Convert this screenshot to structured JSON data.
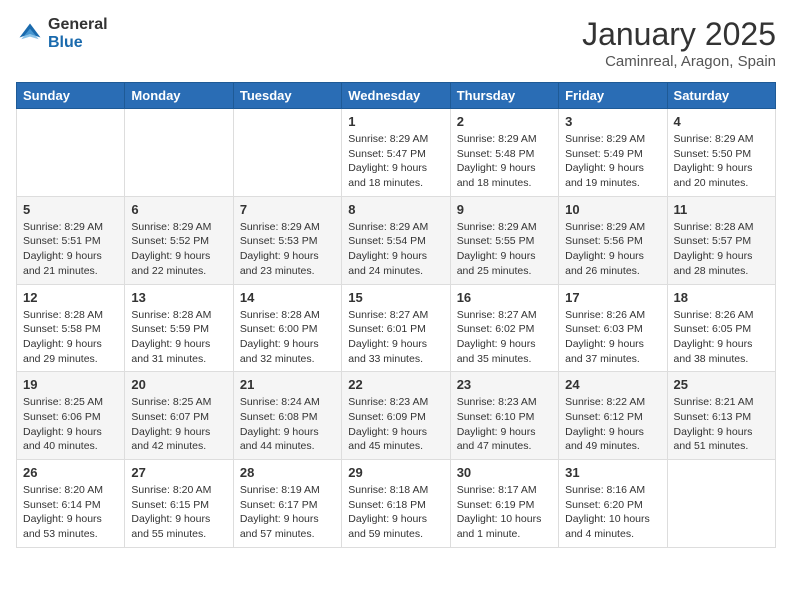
{
  "header": {
    "logo_general": "General",
    "logo_blue": "Blue",
    "month_title": "January 2025",
    "location": "Caminreal, Aragon, Spain"
  },
  "weekdays": [
    "Sunday",
    "Monday",
    "Tuesday",
    "Wednesday",
    "Thursday",
    "Friday",
    "Saturday"
  ],
  "weeks": [
    [
      {
        "day": "",
        "info": ""
      },
      {
        "day": "",
        "info": ""
      },
      {
        "day": "",
        "info": ""
      },
      {
        "day": "1",
        "info": "Sunrise: 8:29 AM\nSunset: 5:47 PM\nDaylight: 9 hours\nand 18 minutes."
      },
      {
        "day": "2",
        "info": "Sunrise: 8:29 AM\nSunset: 5:48 PM\nDaylight: 9 hours\nand 18 minutes."
      },
      {
        "day": "3",
        "info": "Sunrise: 8:29 AM\nSunset: 5:49 PM\nDaylight: 9 hours\nand 19 minutes."
      },
      {
        "day": "4",
        "info": "Sunrise: 8:29 AM\nSunset: 5:50 PM\nDaylight: 9 hours\nand 20 minutes."
      }
    ],
    [
      {
        "day": "5",
        "info": "Sunrise: 8:29 AM\nSunset: 5:51 PM\nDaylight: 9 hours\nand 21 minutes."
      },
      {
        "day": "6",
        "info": "Sunrise: 8:29 AM\nSunset: 5:52 PM\nDaylight: 9 hours\nand 22 minutes."
      },
      {
        "day": "7",
        "info": "Sunrise: 8:29 AM\nSunset: 5:53 PM\nDaylight: 9 hours\nand 23 minutes."
      },
      {
        "day": "8",
        "info": "Sunrise: 8:29 AM\nSunset: 5:54 PM\nDaylight: 9 hours\nand 24 minutes."
      },
      {
        "day": "9",
        "info": "Sunrise: 8:29 AM\nSunset: 5:55 PM\nDaylight: 9 hours\nand 25 minutes."
      },
      {
        "day": "10",
        "info": "Sunrise: 8:29 AM\nSunset: 5:56 PM\nDaylight: 9 hours\nand 26 minutes."
      },
      {
        "day": "11",
        "info": "Sunrise: 8:28 AM\nSunset: 5:57 PM\nDaylight: 9 hours\nand 28 minutes."
      }
    ],
    [
      {
        "day": "12",
        "info": "Sunrise: 8:28 AM\nSunset: 5:58 PM\nDaylight: 9 hours\nand 29 minutes."
      },
      {
        "day": "13",
        "info": "Sunrise: 8:28 AM\nSunset: 5:59 PM\nDaylight: 9 hours\nand 31 minutes."
      },
      {
        "day": "14",
        "info": "Sunrise: 8:28 AM\nSunset: 6:00 PM\nDaylight: 9 hours\nand 32 minutes."
      },
      {
        "day": "15",
        "info": "Sunrise: 8:27 AM\nSunset: 6:01 PM\nDaylight: 9 hours\nand 33 minutes."
      },
      {
        "day": "16",
        "info": "Sunrise: 8:27 AM\nSunset: 6:02 PM\nDaylight: 9 hours\nand 35 minutes."
      },
      {
        "day": "17",
        "info": "Sunrise: 8:26 AM\nSunset: 6:03 PM\nDaylight: 9 hours\nand 37 minutes."
      },
      {
        "day": "18",
        "info": "Sunrise: 8:26 AM\nSunset: 6:05 PM\nDaylight: 9 hours\nand 38 minutes."
      }
    ],
    [
      {
        "day": "19",
        "info": "Sunrise: 8:25 AM\nSunset: 6:06 PM\nDaylight: 9 hours\nand 40 minutes."
      },
      {
        "day": "20",
        "info": "Sunrise: 8:25 AM\nSunset: 6:07 PM\nDaylight: 9 hours\nand 42 minutes."
      },
      {
        "day": "21",
        "info": "Sunrise: 8:24 AM\nSunset: 6:08 PM\nDaylight: 9 hours\nand 44 minutes."
      },
      {
        "day": "22",
        "info": "Sunrise: 8:23 AM\nSunset: 6:09 PM\nDaylight: 9 hours\nand 45 minutes."
      },
      {
        "day": "23",
        "info": "Sunrise: 8:23 AM\nSunset: 6:10 PM\nDaylight: 9 hours\nand 47 minutes."
      },
      {
        "day": "24",
        "info": "Sunrise: 8:22 AM\nSunset: 6:12 PM\nDaylight: 9 hours\nand 49 minutes."
      },
      {
        "day": "25",
        "info": "Sunrise: 8:21 AM\nSunset: 6:13 PM\nDaylight: 9 hours\nand 51 minutes."
      }
    ],
    [
      {
        "day": "26",
        "info": "Sunrise: 8:20 AM\nSunset: 6:14 PM\nDaylight: 9 hours\nand 53 minutes."
      },
      {
        "day": "27",
        "info": "Sunrise: 8:20 AM\nSunset: 6:15 PM\nDaylight: 9 hours\nand 55 minutes."
      },
      {
        "day": "28",
        "info": "Sunrise: 8:19 AM\nSunset: 6:17 PM\nDaylight: 9 hours\nand 57 minutes."
      },
      {
        "day": "29",
        "info": "Sunrise: 8:18 AM\nSunset: 6:18 PM\nDaylight: 9 hours\nand 59 minutes."
      },
      {
        "day": "30",
        "info": "Sunrise: 8:17 AM\nSunset: 6:19 PM\nDaylight: 10 hours\nand 1 minute."
      },
      {
        "day": "31",
        "info": "Sunrise: 8:16 AM\nSunset: 6:20 PM\nDaylight: 10 hours\nand 4 minutes."
      },
      {
        "day": "",
        "info": ""
      }
    ]
  ]
}
